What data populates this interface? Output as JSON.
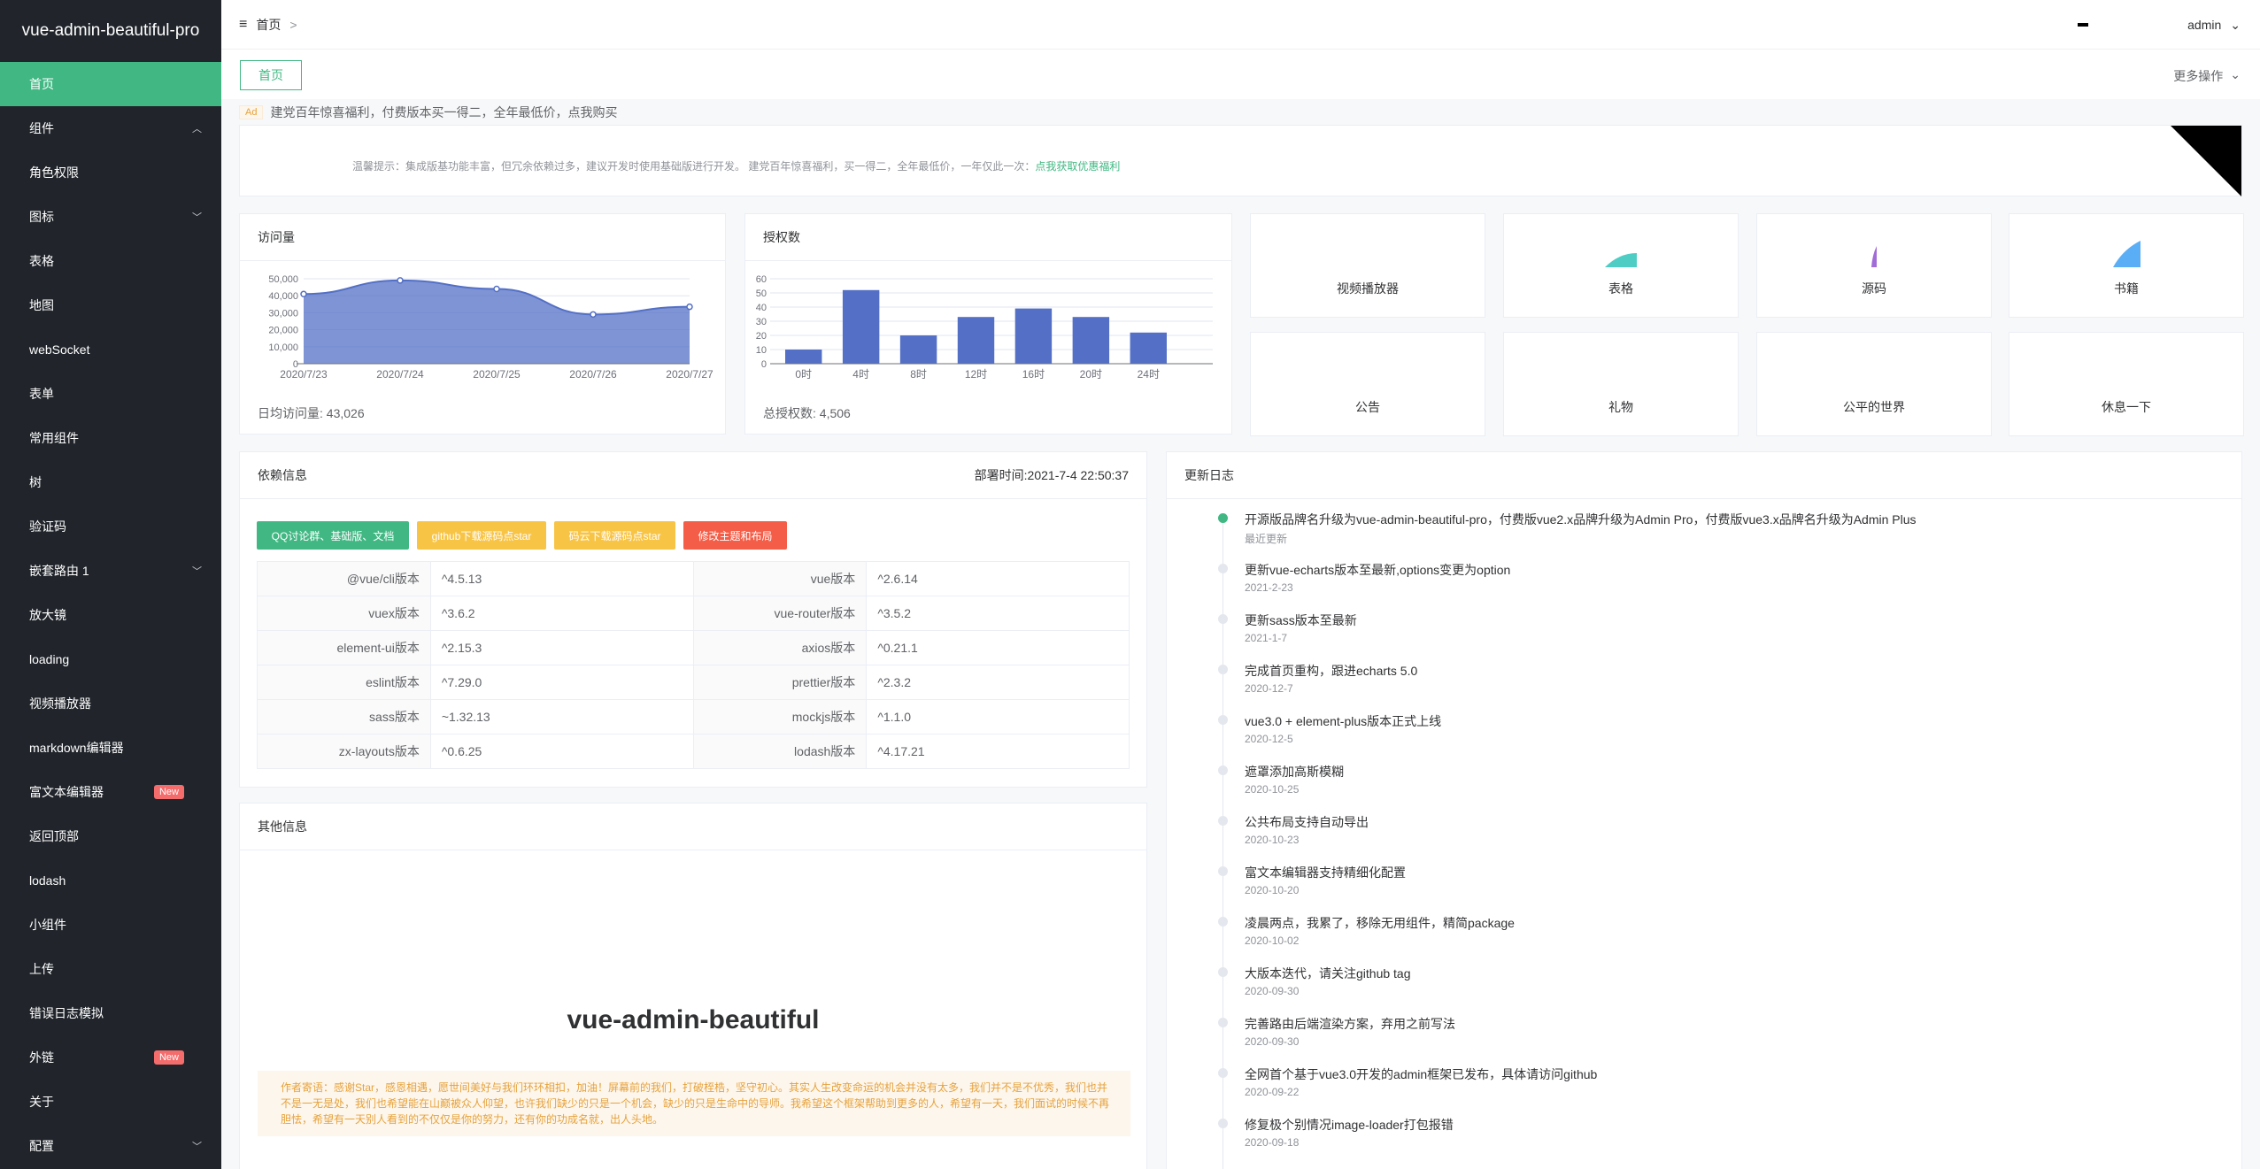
{
  "app": {
    "title": "vue-admin-beautiful-pro"
  },
  "sidebar": {
    "items": [
      {
        "label": "首页",
        "active": true
      },
      {
        "label": "组件",
        "arrow": "chevron-up-icon"
      },
      {
        "label": "角色权限"
      },
      {
        "label": "图标",
        "arrow": "chevron-down-icon"
      },
      {
        "label": "表格"
      },
      {
        "label": "地图"
      },
      {
        "label": "webSocket"
      },
      {
        "label": "表单"
      },
      {
        "label": "常用组件"
      },
      {
        "label": "树"
      },
      {
        "label": "验证码"
      },
      {
        "label": "嵌套路由 1",
        "arrow": "chevron-down-icon"
      },
      {
        "label": "放大镜"
      },
      {
        "label": "loading"
      },
      {
        "label": "视频播放器"
      },
      {
        "label": "markdown编辑器"
      },
      {
        "label": "富文本编辑器",
        "badge": "New"
      },
      {
        "label": "返回顶部"
      },
      {
        "label": "lodash"
      },
      {
        "label": "小组件"
      },
      {
        "label": "上传"
      },
      {
        "label": "错误日志模拟"
      },
      {
        "label": "外链",
        "badge": "New"
      },
      {
        "label": "关于"
      },
      {
        "label": "配置",
        "arrow": "chevron-down-icon"
      }
    ]
  },
  "header": {
    "breadcrumb": "首页",
    "breadcrumb_sep": ">",
    "user": "admin"
  },
  "tabs": {
    "items": [
      {
        "label": "首页"
      }
    ],
    "more": "更多操作"
  },
  "ad": {
    "tag": "Ad",
    "text": "建党百年惊喜福利，付费版本买一得二，全年最低价，点我购买"
  },
  "tip": {
    "text": "温馨提示：集成版基功能丰富，但冗余依赖过多，建议开发时使用基础版进行开发。 建党百年惊喜福利，买一得二，全年最低价，一年仅此一次：",
    "link": "点我获取优惠福利"
  },
  "visits": {
    "title": "访问量",
    "footer": "日均访问量: 43,026"
  },
  "auth": {
    "title": "授权数",
    "footer": "总授权数: 4,506"
  },
  "chart_data": [
    {
      "type": "area",
      "title": "访问量",
      "categories": [
        "2020/7/23",
        "2020/7/24",
        "2020/7/25",
        "2020/7/26",
        "2020/7/27"
      ],
      "values": [
        41000,
        49000,
        44000,
        29000,
        33500
      ],
      "ylim": [
        0,
        50000
      ],
      "yticks": [
        "50,000",
        "40,000",
        "30,000",
        "20,000",
        "10,000",
        "0"
      ],
      "color": "#5470c6",
      "grid": true
    },
    {
      "type": "bar",
      "title": "授权数",
      "categories": [
        "0时",
        "4时",
        "8时",
        "12时",
        "16时",
        "20时",
        "24时"
      ],
      "values": [
        10,
        52,
        20,
        33,
        39,
        33,
        22
      ],
      "ylim": [
        0,
        60
      ],
      "yticks": [
        "60",
        "50",
        "40",
        "30",
        "20",
        "10",
        "0"
      ],
      "color": "#5470c6",
      "grid": true
    }
  ],
  "tiles": [
    {
      "label": "视频播放器",
      "icon": "video-icon"
    },
    {
      "label": "表格",
      "icon": "table-icon",
      "color": "#4ecdc4"
    },
    {
      "label": "源码",
      "icon": "code-icon",
      "color": "#a26cd8"
    },
    {
      "label": "书籍",
      "icon": "book-icon",
      "color": "#5aaef5"
    },
    {
      "label": "公告",
      "icon": "notice-icon"
    },
    {
      "label": "礼物",
      "icon": "gift-icon"
    },
    {
      "label": "公平的世界",
      "icon": "globe-icon"
    },
    {
      "label": "休息一下",
      "icon": "coffee-icon"
    }
  ],
  "deps": {
    "title": "依赖信息",
    "deploy_time": "部署时间:2021-7-4 22:50:37",
    "buttons": [
      {
        "label": "QQ讨论群、基础版、文档",
        "color": "#41b883"
      },
      {
        "label": "github下载源码点star",
        "color": "#f8c446"
      },
      {
        "label": "码云下载源码点star",
        "color": "#f8c446"
      },
      {
        "label": "修改主题和布局",
        "color": "#f45d47"
      }
    ],
    "rows": [
      [
        "@vue/cli版本",
        "^4.5.13",
        "vue版本",
        "^2.6.14"
      ],
      [
        "vuex版本",
        "^3.6.2",
        "vue-router版本",
        "^3.5.2"
      ],
      [
        "element-ui版本",
        "^2.15.3",
        "axios版本",
        "^0.21.1"
      ],
      [
        "eslint版本",
        "^7.29.0",
        "prettier版本",
        "^2.3.2"
      ],
      [
        "sass版本",
        "~1.32.13",
        "mockjs版本",
        "^1.1.0"
      ],
      [
        "zx-layouts版本",
        "^0.6.25",
        "lodash版本",
        "^4.17.21"
      ]
    ]
  },
  "other": {
    "title": "其他信息",
    "heading": "vue-admin-beautiful",
    "note": "作者寄语：感谢Star，感恩相遇，愿世间美好与我们环环相扣，加油！屏幕前的我们，打破桎梏，坚守初心。其实人生改变命运的机会并没有太多，我们并不是不优秀，我们也并不是一无是处，我们也希望能在山巅被众人仰望，也许我们缺少的只是一个机会，缺少的只是生命中的导师。我希望这个框架帮助到更多的人，希望有一天，我们面试的时候不再胆怯，希望有一天别人看到的不仅仅是你的努力，还有你的功成名就，出人头地。"
  },
  "changelog": {
    "title": "更新日志",
    "items": [
      {
        "title": "开源版品牌名升级为vue-admin-beautiful-pro，付费版vue2.x品牌升级为Admin Pro，付费版vue3.x品牌名升级为Admin Plus",
        "date": "最近更新",
        "active": true
      },
      {
        "title": "更新vue-echarts版本至最新,options变更为option",
        "date": "2021-2-23"
      },
      {
        "title": "更新sass版本至最新",
        "date": "2021-1-7"
      },
      {
        "title": "完成首页重构，跟进echarts 5.0",
        "date": "2020-12-7"
      },
      {
        "title": "vue3.0 + element-plus版本正式上线",
        "date": "2020-12-5"
      },
      {
        "title": "遮罩添加高斯模糊",
        "date": "2020-10-25"
      },
      {
        "title": "公共布局支持自动导出",
        "date": "2020-10-23"
      },
      {
        "title": "富文本编辑器支持精细化配置",
        "date": "2020-10-20"
      },
      {
        "title": "凌晨两点，我累了，移除无用组件，精简package",
        "date": "2020-10-02"
      },
      {
        "title": "大版本迭代，请关注github tag",
        "date": "2020-09-30"
      },
      {
        "title": "完善路由后端渲染方案，弃用之前写法",
        "date": "2020-09-30"
      },
      {
        "title": "全网首个基于vue3.0开发的admin框架已发布，具体请访问github",
        "date": "2020-09-22"
      },
      {
        "title": "修复极个别情况image-loader打包报错",
        "date": "2020-09-18"
      }
    ]
  }
}
